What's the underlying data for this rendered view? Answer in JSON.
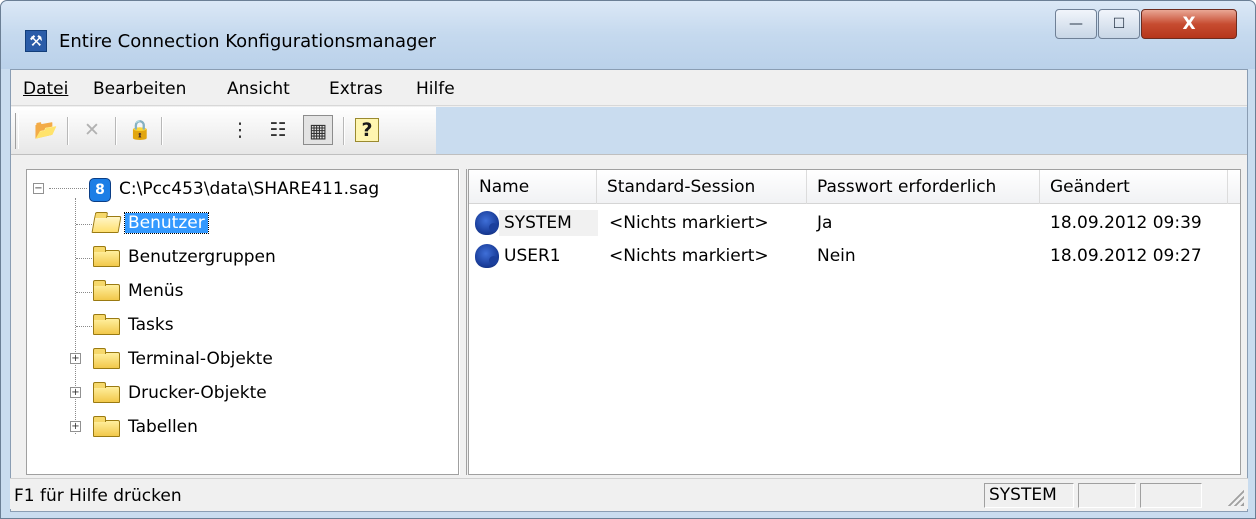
{
  "window": {
    "title": "Entire Connection Konfigurationsmanager",
    "app_icon": "tools-icon",
    "buttons": {
      "minimize": "—",
      "maximize": "☐",
      "close": "X"
    }
  },
  "menubar": [
    {
      "label": "Datei"
    },
    {
      "label": "Bearbeiten"
    },
    {
      "label": "Ansicht"
    },
    {
      "label": "Extras"
    },
    {
      "label": "Hilfe"
    }
  ],
  "toolbar": [
    {
      "icon": "open-folder-icon",
      "glyph": "📂",
      "enabled": true
    },
    {
      "icon": "delete-icon",
      "glyph": "✕",
      "enabled": false
    },
    {
      "icon": "lock-icon",
      "glyph": "🔒",
      "enabled": false
    },
    {
      "icon": "large-icons-view-icon",
      "glyph": "⋮",
      "enabled": true
    },
    {
      "icon": "list-view-icon",
      "glyph": "☷",
      "enabled": true
    },
    {
      "icon": "details-view-icon",
      "glyph": "▦",
      "enabled": true,
      "pressed": true
    },
    {
      "icon": "context-help-icon",
      "glyph": "?",
      "enabled": true
    }
  ],
  "tree": {
    "root": {
      "label": "C:\\Pcc453\\data\\SHARE411.sag",
      "expander": "−"
    },
    "children": [
      {
        "label": "Benutzer",
        "selected": true,
        "open": true,
        "expandable": false
      },
      {
        "label": "Benutzergruppen",
        "expandable": false
      },
      {
        "label": "Menüs",
        "expandable": false
      },
      {
        "label": "Tasks",
        "expandable": false
      },
      {
        "label": "Terminal-Objekte",
        "expandable": true,
        "expander": "+"
      },
      {
        "label": "Drucker-Objekte",
        "expandable": true,
        "expander": "+"
      },
      {
        "label": "Tabellen",
        "expandable": true,
        "expander": "+"
      }
    ]
  },
  "list": {
    "columns": [
      "Name",
      "Standard-Session",
      "Passwort erforderlich",
      "Geändert"
    ],
    "rows": [
      {
        "name": "SYSTEM",
        "session": "<Nichts markiert>",
        "password": "Ja",
        "changed": "18.09.2012  09:39"
      },
      {
        "name": "USER1",
        "session": "<Nichts markiert>",
        "password": "Nein",
        "changed": "18.09.2012  09:27"
      }
    ]
  },
  "statusbar": {
    "help_text": "F1 für Hilfe drücken",
    "user": "SYSTEM",
    "pane2": "",
    "pane3": ""
  },
  "colors": {
    "selection": "#3399ff",
    "title_gradient_top": "#dbe8f6",
    "close_button": "#c74c31"
  }
}
